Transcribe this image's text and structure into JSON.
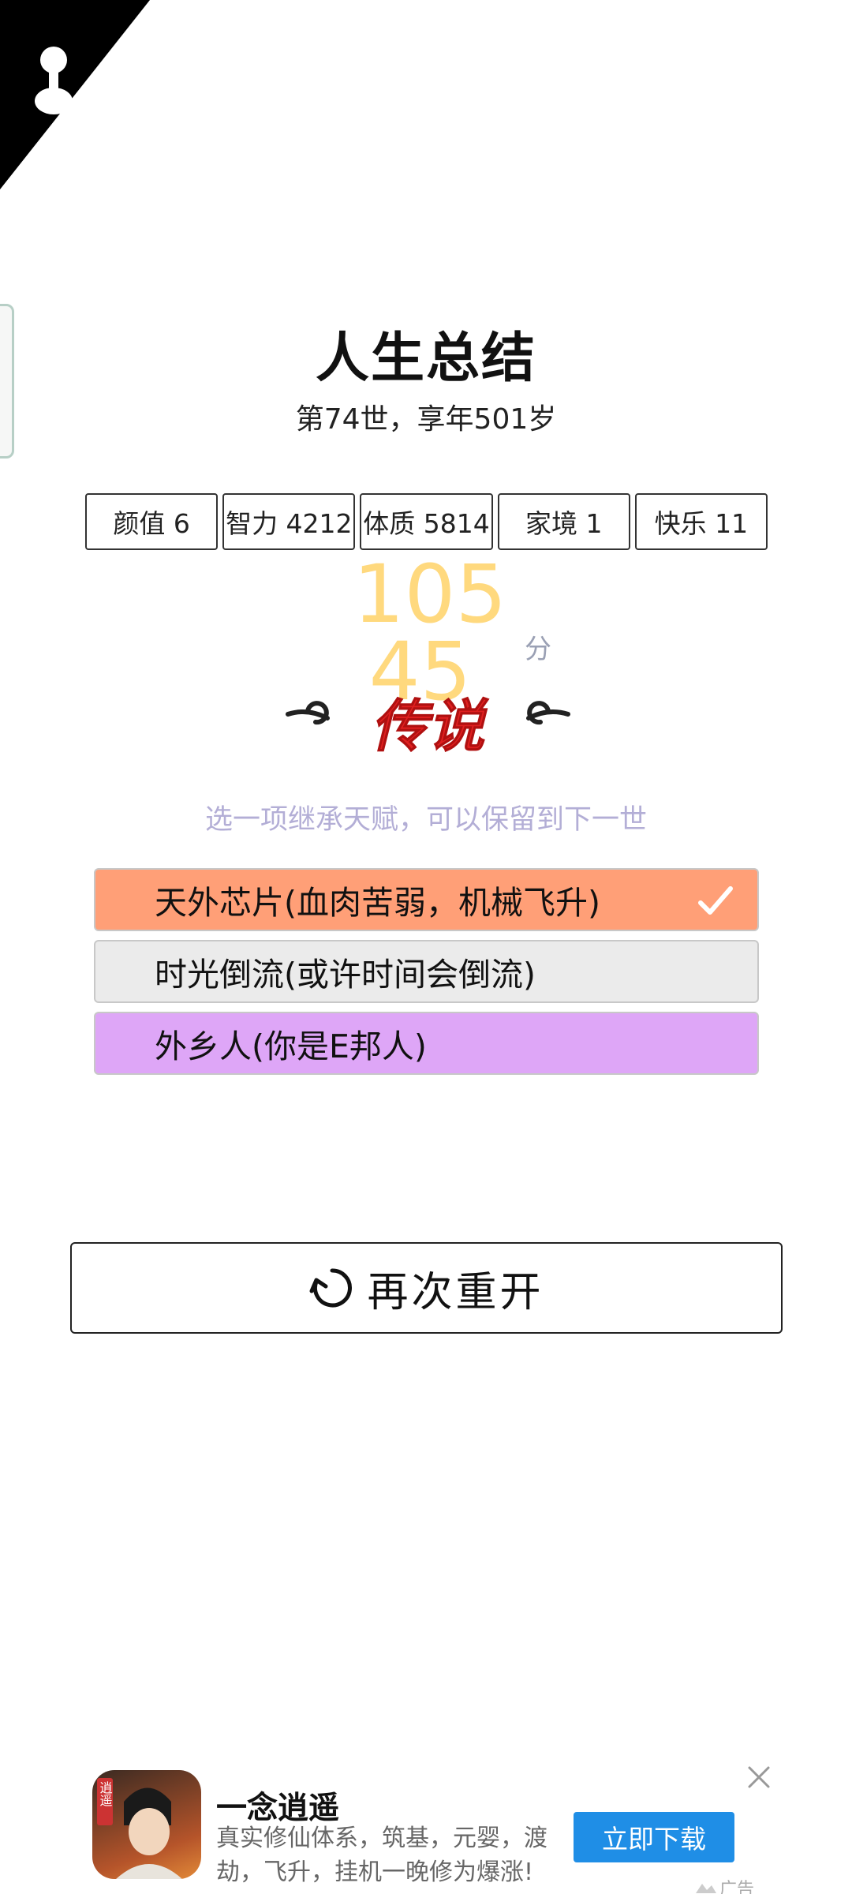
{
  "summary": {
    "title": "人生总结",
    "subtitle": "第74世，享年501岁"
  },
  "stats": [
    {
      "label": "颜值 6"
    },
    {
      "label": "智力 4212"
    },
    {
      "label": "体质 5814"
    },
    {
      "label": "家境 1"
    },
    {
      "label": "快乐 11"
    }
  ],
  "score": {
    "line1": "105",
    "line2": "45",
    "unit": "分",
    "color": "#ffd97e"
  },
  "grade": {
    "text": "传说",
    "color": "#e02020"
  },
  "talent_hint": "选一项继承天赋，可以保留到下一世",
  "talents": [
    {
      "label": "天外芯片(血肉苦弱，机械飞升)",
      "selected": true,
      "color": "#ff9f77"
    },
    {
      "label": "时光倒流(或许时间会倒流)",
      "selected": false,
      "color": "#ebebeb"
    },
    {
      "label": "外乡人(你是E邦人)",
      "selected": false,
      "color": "#dea6f7"
    }
  ],
  "restart": {
    "label": "再次重开",
    "icon": "refresh-icon"
  },
  "ad": {
    "app_name": "一念逍遥",
    "description": "真实修仙体系，筑基，元婴，渡劫，飞升，挂机一晚修为爆涨!",
    "cta": "立即下载",
    "tag": "广告",
    "icon_text": "逍遥",
    "button_color": "#1f8ee6"
  }
}
